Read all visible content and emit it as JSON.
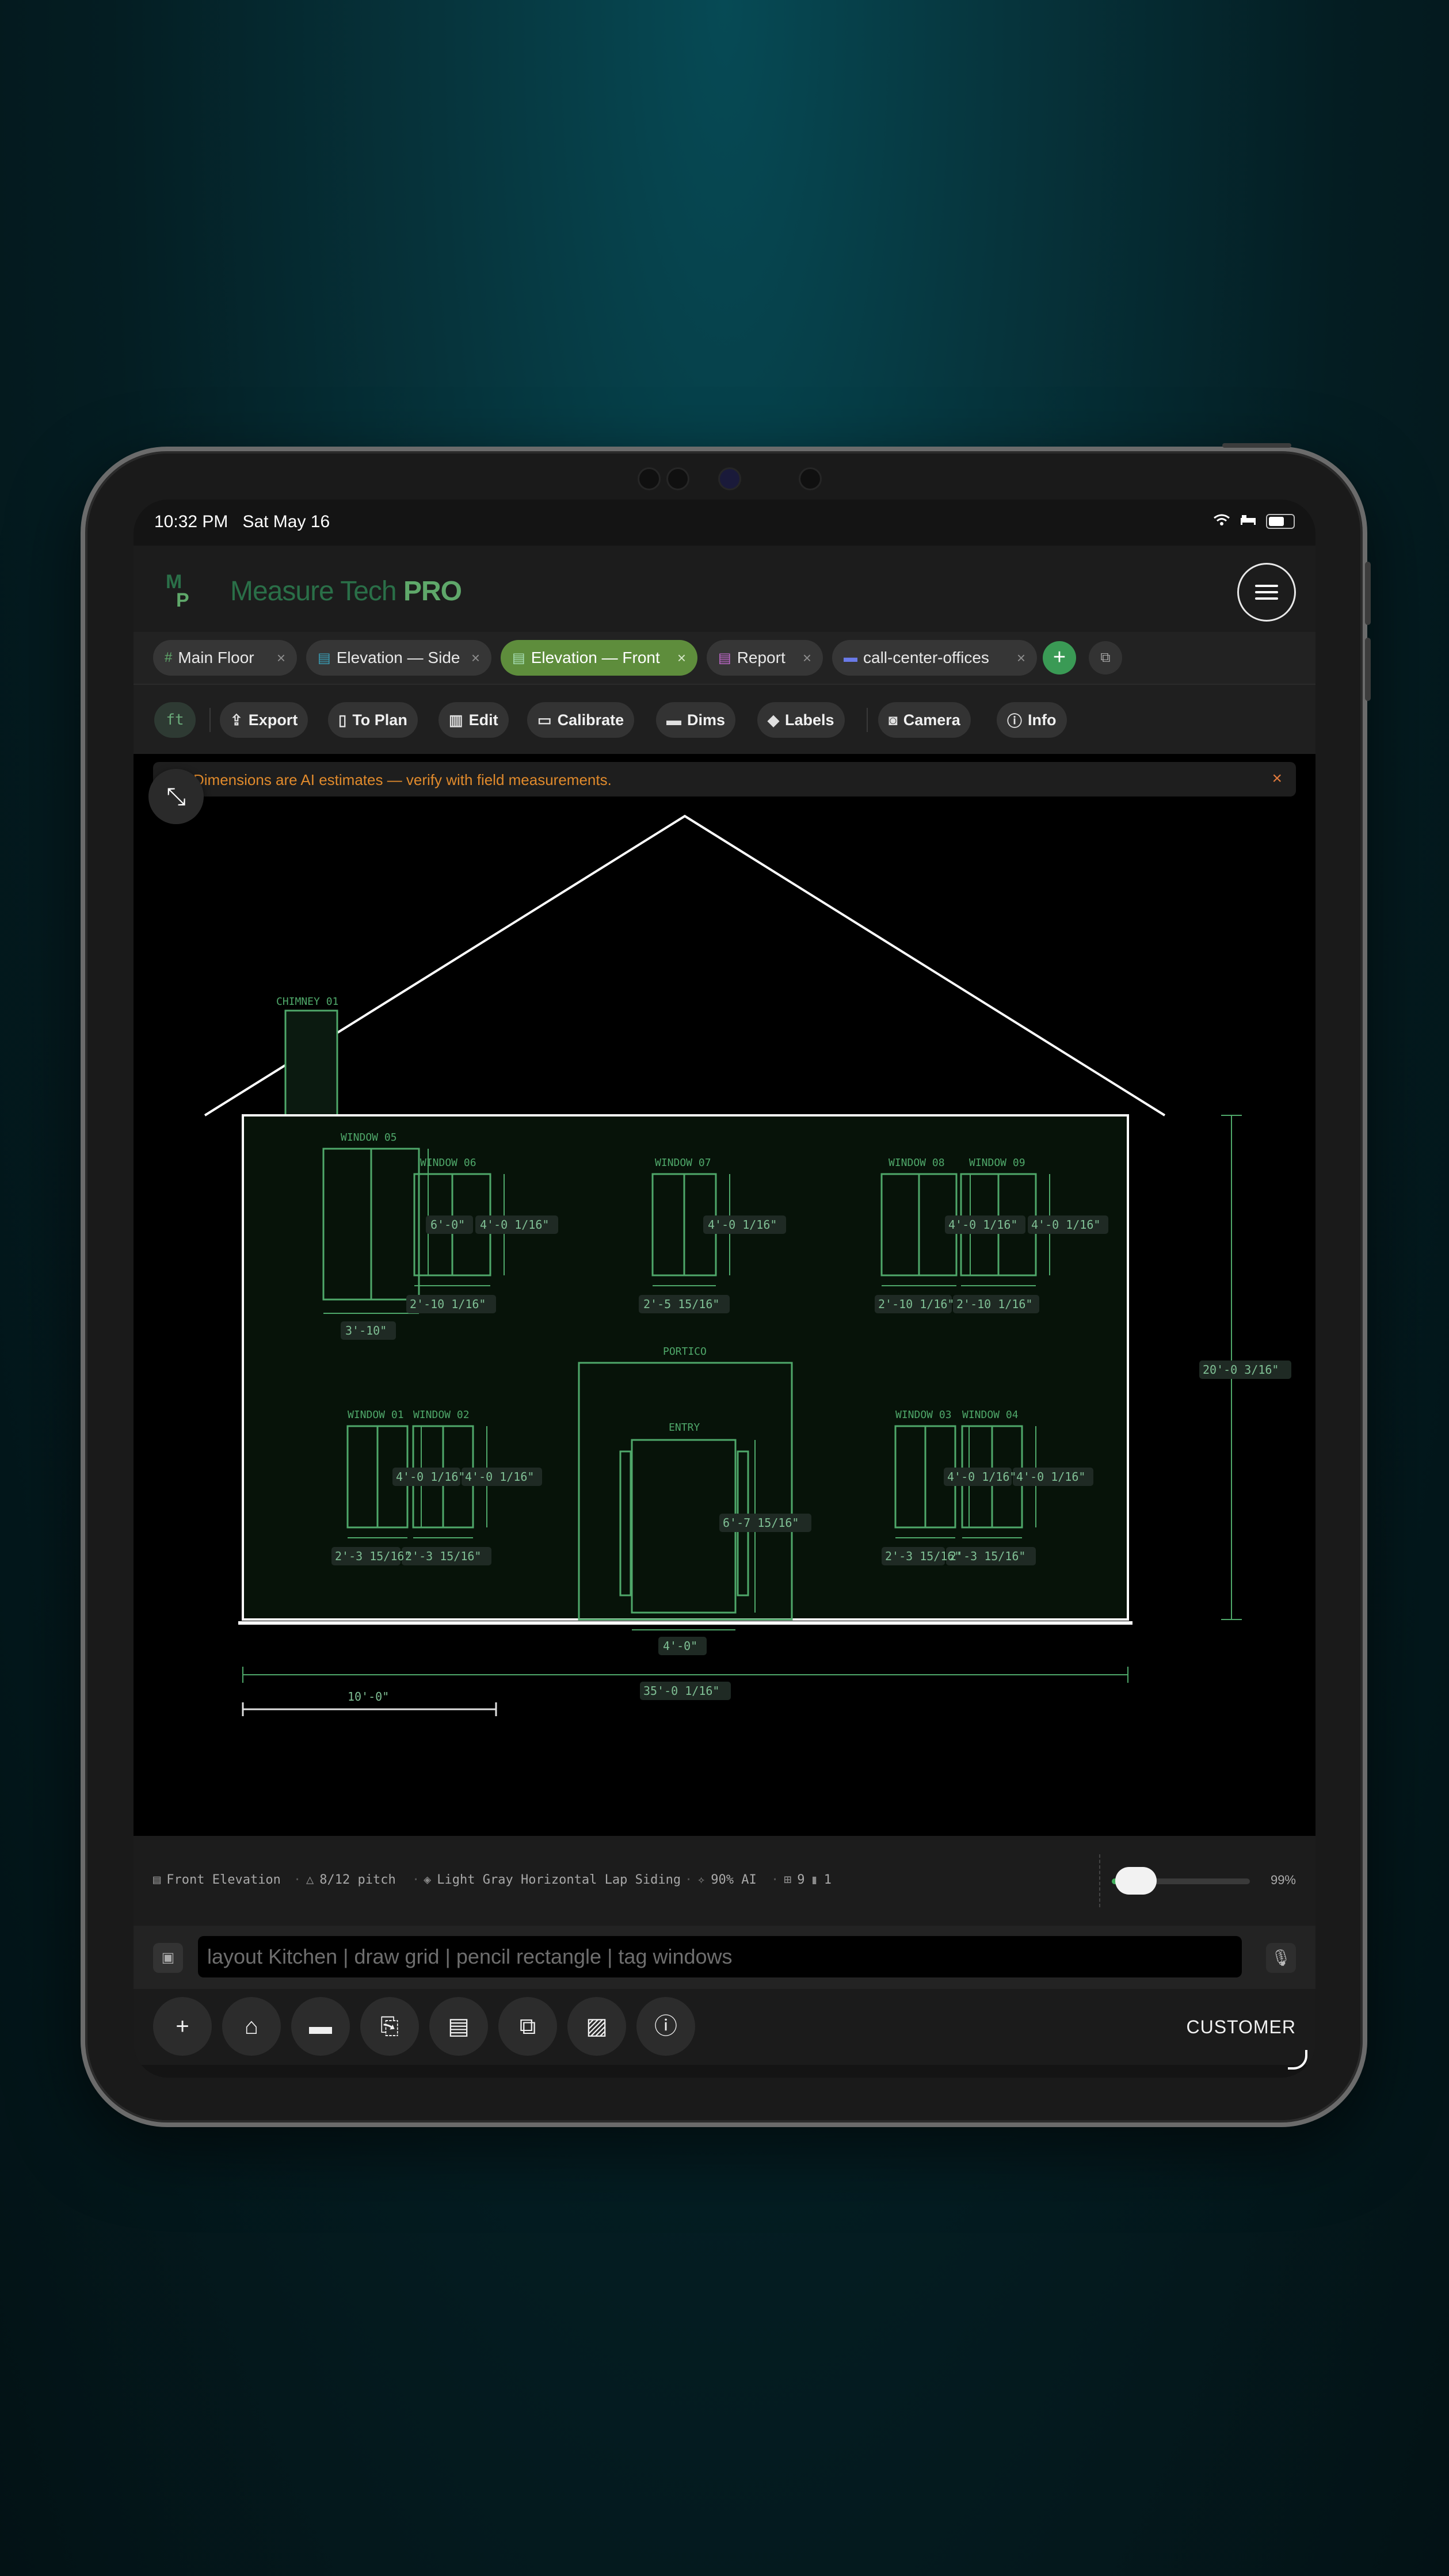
{
  "status": {
    "time": "10:32 PM",
    "date": "Sat May 16"
  },
  "brand": {
    "name_light": "Measure Tech ",
    "name_bold": "PRO"
  },
  "tabs": [
    {
      "label": "Main Floor",
      "icon": "grid-icon"
    },
    {
      "label": "Elevation — Side",
      "icon": "document-icon"
    },
    {
      "label": "Elevation — Front",
      "icon": "document-icon",
      "active": true
    },
    {
      "label": "Report",
      "icon": "report-icon"
    },
    {
      "label": "call-center-offices",
      "icon": "layout-icon"
    }
  ],
  "tab_close": "×",
  "tab_add": "+",
  "toolbar": {
    "unit": "ft",
    "export": "Export",
    "to_plan": "To Plan",
    "edit": "Edit",
    "calibrate": "Calibrate",
    "dims": "Dims",
    "labels": "Labels",
    "camera": "Camera",
    "info": "Info"
  },
  "banner": {
    "text": "Dimensions are AI estimates — verify with field measurements.",
    "close": "×"
  },
  "drawing": {
    "labels": {
      "chimney": "CHIMNEY 01",
      "window05": "WINDOW 05",
      "window06": "WINDOW 06",
      "window07": "WINDOW 07",
      "window08": "WINDOW 08",
      "window09": "WINDOW 09",
      "portico": "PORTICO",
      "entry": "ENTRY",
      "window01": "WINDOW 01",
      "window02": "WINDOW 02",
      "window03": "WINDOW 03",
      "window04": "WINDOW 04"
    },
    "dims": {
      "w05_height": "6'-0\"",
      "w06_height": "4'-0 1/16\"",
      "w07_height": "4'-0 1/16\"",
      "w08_height": "4'-0 1/16\"",
      "w09_height": "4'-0 1/16\"",
      "w05_width": "3'-10\"",
      "w06_width": "2'-10 1/16\"",
      "w07_width": "2'-5 15/16\"",
      "w08_width": "2'-10 1/16\"",
      "w09_width": "2'-10 1/16\"",
      "w01_height": "4'-0 1/16\"",
      "w02_height": "4'-0 1/16\"",
      "w03_height": "4'-0 1/16\"",
      "w04_height": "4'-0 1/16\"",
      "w01_width": "2'-3 15/16\"",
      "w02_width": "2'-3 15/16\"",
      "w03_width": "2'-3 15/16\"",
      "w04_width": "2'-3 15/16\"",
      "entry_height": "6'-7 15/16\"",
      "entry_width": "4'-0\"",
      "overall_height": "20'-0 3/16\"",
      "overall_width": "35'-0 1/16\"",
      "scale_bar": "10'-0\""
    }
  },
  "stats": {
    "view": "Front Elevation",
    "pitch": "8/12 pitch",
    "siding": "Light Gray Horizontal Lap Siding",
    "ai": "90% AI",
    "windows": "9",
    "doors": "1"
  },
  "opacity": {
    "value": 0.99,
    "label": "99%"
  },
  "command": {
    "placeholder": "layout Kitchen | draw grid | pencil rectangle | tag windows"
  },
  "role": "CUSTOMER",
  "colors": {
    "accent": "#3a9a55",
    "active_tab": "#5e8d3c",
    "warning": "#e08a2c",
    "drawing_green": "#4fa86a"
  }
}
